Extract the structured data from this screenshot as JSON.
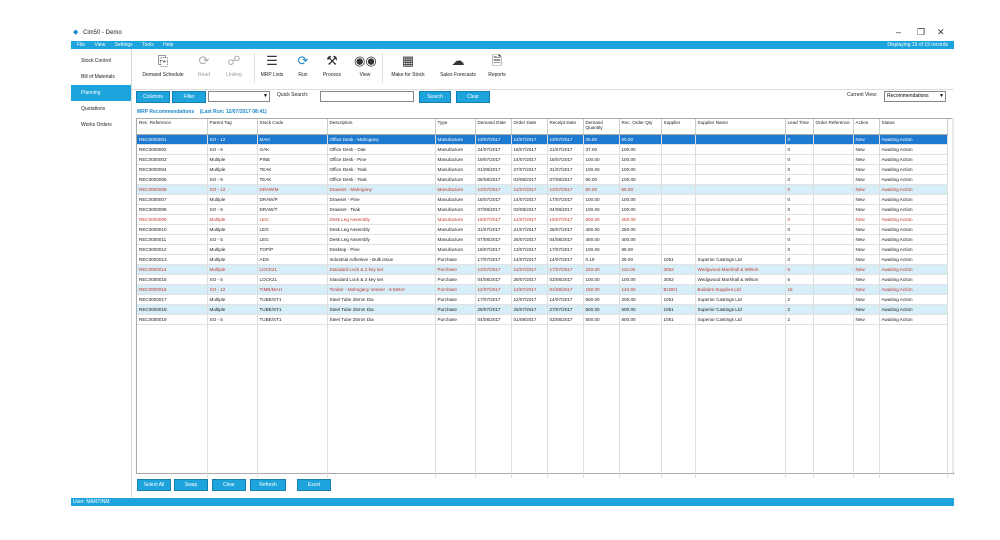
{
  "window": {
    "title": "Cim50 - Demo",
    "controls": [
      "–",
      "❐",
      "✕"
    ]
  },
  "menu": {
    "items": [
      "File",
      "View",
      "Settings",
      "Tools",
      "Help"
    ],
    "display_info": "Displaying 19 of 19 records"
  },
  "sidebar": {
    "items": [
      {
        "label": "Stock Control",
        "active": false
      },
      {
        "label": "Bill of Materials",
        "active": false
      },
      {
        "label": "Planning",
        "active": true
      },
      {
        "label": "Quotations",
        "active": false
      },
      {
        "label": "Works Orders",
        "active": false
      }
    ]
  },
  "toolbar": {
    "demand_schedule": "Demand Schedule",
    "read": "Read",
    "linking": "Linking",
    "mrp_lists": "MRP Lists",
    "run": "Run",
    "process": "Process",
    "view": "View",
    "make_for_stock": "Make for Stock",
    "sales_forecasts": "Sales Forecasts",
    "reports": "Reports"
  },
  "filters": {
    "columns_button": "Columns",
    "filter_button": "Filter",
    "quick_search_label": "Quick Search:",
    "search_button": "Search",
    "clear_button": "Clear",
    "current_view_label": "Current View:",
    "current_view_value": "Recommendations"
  },
  "grid_title": {
    "name": "MRP Recommendations",
    "last_run": "(Last Run: 12/07/2017 08:41)"
  },
  "table": {
    "columns": [
      "Rec. Reference",
      "Parent Tag",
      "Stock Code",
      "Description",
      "Type",
      "Demand Date",
      "Order Date",
      "Receipt Date",
      "Demand Quantity",
      "Rec. Order Qty",
      "Supplier",
      "Supplier Name",
      "Lead Time",
      "Order Reference",
      "Action",
      "Status"
    ],
    "rows": [
      {
        "cells": [
          "REC0000001",
          "SO - 12",
          "MAH",
          "Office Desk - Mahogany",
          "Manufacture",
          "13/07/2017",
          "12/07/2017",
          "13/07/2017",
          "25.00",
          "50.00",
          "",
          "",
          "0",
          "",
          "New",
          "Awaiting Action"
        ],
        "style": "selected"
      },
      {
        "cells": [
          "REC0000002",
          "SO - 6",
          "OAK",
          "Office Desk - Oak",
          "Manufacture",
          "24/07/2017",
          "18/07/2017",
          "21/07/2017",
          "37.00",
          "100.00",
          "",
          "",
          "0",
          "",
          "New",
          "Awaiting Action"
        ],
        "style": "normal"
      },
      {
        "cells": [
          "REC0000003",
          "Multiple",
          "PINE",
          "Office Desk - Pine",
          "Manufacture",
          "19/07/2017",
          "14/07/2017",
          "18/07/2017",
          "100.00",
          "100.00",
          "",
          "",
          "0",
          "",
          "New",
          "Awaiting Action"
        ],
        "style": "normal"
      },
      {
        "cells": [
          "REC0000004",
          "Multiple",
          "TEAK",
          "Office Desk - Teak",
          "Manufacture",
          "01/08/2017",
          "27/07/2017",
          "31/07/2017",
          "100.00",
          "100.00",
          "",
          "",
          "0",
          "",
          "New",
          "Awaiting Action"
        ],
        "style": "normal"
      },
      {
        "cells": [
          "REC0000005",
          "SO - 5",
          "TEAK",
          "Office Desk - Teak",
          "Manufacture",
          "08/08/2017",
          "03/08/2017",
          "07/08/2017",
          "90.00",
          "100.00",
          "",
          "",
          "0",
          "",
          "New",
          "Awaiting Action"
        ],
        "style": "normal"
      },
      {
        "cells": [
          "REC0000006",
          "SO - 12",
          "DRAW/M",
          "Drawset - Mahogany",
          "Manufacture",
          "12/07/2017",
          "12/07/2017",
          "12/07/2017",
          "50.00",
          "50.00",
          "",
          "",
          "0",
          "",
          "New",
          "Awaiting Action"
        ],
        "style": "alt-red"
      },
      {
        "cells": [
          "REC0000007",
          "Multiple",
          "DRAW/P",
          "Drawset - Pine",
          "Manufacture",
          "18/07/2017",
          "14/07/2017",
          "17/07/2017",
          "100.00",
          "100.00",
          "",
          "",
          "0",
          "",
          "New",
          "Awaiting Action"
        ],
        "style": "normal"
      },
      {
        "cells": [
          "REC0000008",
          "SO - 5",
          "DRAW/T",
          "Drawset - Teak",
          "Manufacture",
          "07/08/2017",
          "03/08/2017",
          "04/08/2017",
          "100.00",
          "100.00",
          "",
          "",
          "0",
          "",
          "New",
          "Awaiting Action"
        ],
        "style": "normal"
      },
      {
        "cells": [
          "REC0000009",
          "Multiple",
          "LEG",
          "Desk Leg Assembly",
          "Manufacture",
          "18/07/2017",
          "12/07/2017",
          "19/07/2017",
          "600.00",
          "250.00",
          "",
          "",
          "0",
          "",
          "New",
          "Awaiting Action"
        ],
        "style": "red"
      },
      {
        "cells": [
          "REC0000010",
          "Multiple",
          "LEG",
          "Desk Leg Assembly",
          "Manufacture",
          "31/07/2017",
          "21/07/2017",
          "28/07/2017",
          "400.00",
          "250.00",
          "",
          "",
          "0",
          "",
          "New",
          "Awaiting Action"
        ],
        "style": "normal"
      },
      {
        "cells": [
          "REC0000011",
          "SO - 5",
          "LEG",
          "Desk Leg Assembly",
          "Manufacture",
          "07/08/2017",
          "26/07/2017",
          "04/08/2017",
          "400.00",
          "400.00",
          "",
          "",
          "0",
          "",
          "New",
          "Awaiting Action"
        ],
        "style": "normal"
      },
      {
        "cells": [
          "REC0000012",
          "Multiple",
          "TOP/P",
          "Desktop - Pine",
          "Manufacture",
          "18/07/2017",
          "13/07/2017",
          "17/07/2017",
          "100.00",
          "95.00",
          "",
          "",
          "0",
          "",
          "New",
          "Awaiting Action"
        ],
        "style": "normal"
      },
      {
        "cells": [
          "REC0000013",
          "Multiple",
          "ADS",
          "Industrial Adhesive - Bulk issue",
          "Purchase",
          "17/07/2017",
          "14/07/2017",
          "14/07/2017",
          "0.19",
          "25.00",
          "1051",
          "Superior Castings Ltd",
          "0",
          "",
          "New",
          "Awaiting Action"
        ],
        "style": "normal"
      },
      {
        "cells": [
          "REC0000014",
          "Multiple",
          "LOCK2L",
          "Standard Lock & 2 key set",
          "Purchase",
          "12/07/2017",
          "12/07/2017",
          "17/07/2017",
          "220.00",
          "110.00",
          "3052",
          "Wedgwood Marshall & Wilson",
          "5",
          "",
          "New",
          "Awaiting Action"
        ],
        "style": "alt-red"
      },
      {
        "cells": [
          "REC0000015",
          "SO - 5",
          "LOCK2L",
          "Standard Lock & 2 key set",
          "Purchase",
          "04/08/2017",
          "28/07/2017",
          "03/08/2017",
          "100.00",
          "100.00",
          "3052",
          "Wedgwood Marshall & Wilson",
          "5",
          "",
          "New",
          "Awaiting Action"
        ],
        "style": "normal"
      },
      {
        "cells": [
          "REC0000016",
          "SO - 12",
          "TIMB/MAH",
          "Timber - Mahogany Veneer - 6 Metre",
          "Purchase",
          "12/07/2017",
          "12/07/2017",
          "01/08/2017",
          "150.00",
          "140.00",
          "BU001",
          "Builders Supplies Ltd",
          "15",
          "",
          "New",
          "Awaiting Action"
        ],
        "style": "alt-red"
      },
      {
        "cells": [
          "REC0000017",
          "Multiple",
          "TUBE/ST1",
          "Steel Tube 25mm Dia",
          "Purchase",
          "17/07/2017",
          "12/07/2017",
          "14/07/2017",
          "500.00",
          "200.00",
          "1051",
          "Superior Castings Ltd",
          "2",
          "",
          "New",
          "Awaiting Action"
        ],
        "style": "normal"
      },
      {
        "cells": [
          "REC0000018",
          "Multiple",
          "TUBE/ST1",
          "Steel Tube 25mm Dia",
          "Purchase",
          "28/07/2017",
          "25/07/2017",
          "27/07/2017",
          "500.00",
          "500.00",
          "1051",
          "Superior Castings Ltd",
          "2",
          "",
          "New",
          "Awaiting Action"
        ],
        "style": "alt"
      },
      {
        "cells": [
          "REC0000019",
          "SO - 5",
          "TUBE/ST1",
          "Steel Tube 25mm Dia",
          "Purchase",
          "04/08/2017",
          "01/08/2017",
          "03/08/2017",
          "500.00",
          "800.00",
          "1051",
          "Superior Castings Ltd",
          "2",
          "",
          "New",
          "Awaiting Action"
        ],
        "style": "normal"
      }
    ]
  },
  "bottom_buttons": {
    "select_all": "Select All",
    "swap": "Swap",
    "clear": "Clear",
    "refresh": "Refresh",
    "excel": "Excel"
  },
  "status": {
    "user": "User: MARTINM"
  },
  "colors": {
    "accent": "#1ea4dd",
    "selected_row": "#1e7ad0",
    "alt_row": "#d7eef9",
    "warning_text": "#c0392b"
  }
}
